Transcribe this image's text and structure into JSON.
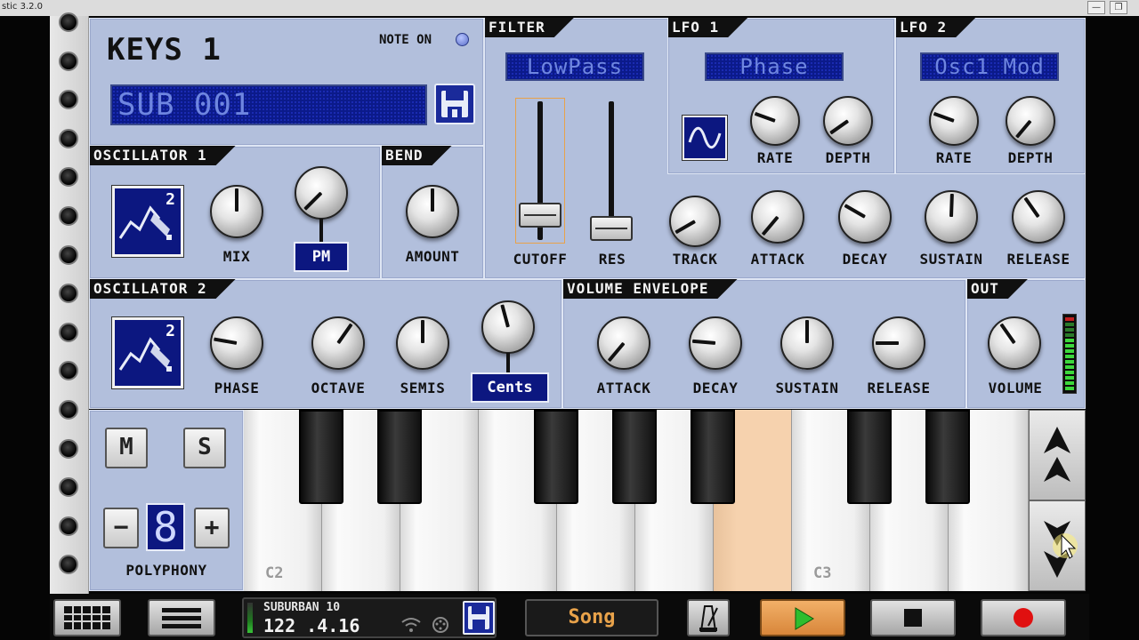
{
  "window": {
    "title": "stic 3.2.0",
    "min": "—",
    "restore": "❐"
  },
  "keys": {
    "title": "KEYS 1",
    "note_on": "NOTE ON",
    "preset": "SUB 001"
  },
  "osc1": {
    "label": "OSCILLATOR 1",
    "wave_num": "2",
    "mix": "MIX",
    "pm": "PM"
  },
  "bend": {
    "label": "BEND",
    "amount": "AMOUNT"
  },
  "filter": {
    "label": "FILTER",
    "type": "LowPass",
    "cutoff": "CUTOFF",
    "res": "RES",
    "track": "TRACK",
    "attack": "ATTACK",
    "decay": "DECAY",
    "sustain": "SUSTAIN",
    "release": "RELEASE"
  },
  "lfo1": {
    "label": "LFO 1",
    "target": "Phase",
    "rate": "RATE",
    "depth": "DEPTH"
  },
  "lfo2": {
    "label": "LFO 2",
    "target": "Osc1 Mod",
    "rate": "RATE",
    "depth": "DEPTH"
  },
  "osc2": {
    "label": "OSCILLATOR 2",
    "wave_num": "2",
    "phase": "PHASE",
    "octave": "OCTAVE",
    "semis": "SEMIS",
    "cents": "Cents"
  },
  "vol_env": {
    "label": "VOLUME ENVELOPE",
    "attack": "ATTACK",
    "decay": "DECAY",
    "sustain": "SUSTAIN",
    "release": "RELEASE"
  },
  "out": {
    "label": "OUT",
    "volume": "VOLUME"
  },
  "voice": {
    "mute": "M",
    "solo": "S",
    "minus": "−",
    "plus": "+",
    "polyphony_value": "8",
    "polyphony": "POLYPHONY"
  },
  "piano": {
    "c2": "C2",
    "c3": "C3"
  },
  "transport": {
    "song_name": "SUBURBAN 10",
    "position": "122 .4.16",
    "song_button": "Song"
  },
  "colors": {
    "panel": "#b2bfdc",
    "display": "#0b1a8a",
    "display_text": "#6f86e0",
    "pressed_key": "#f6d2ae",
    "song_text": "#e8a24a"
  }
}
